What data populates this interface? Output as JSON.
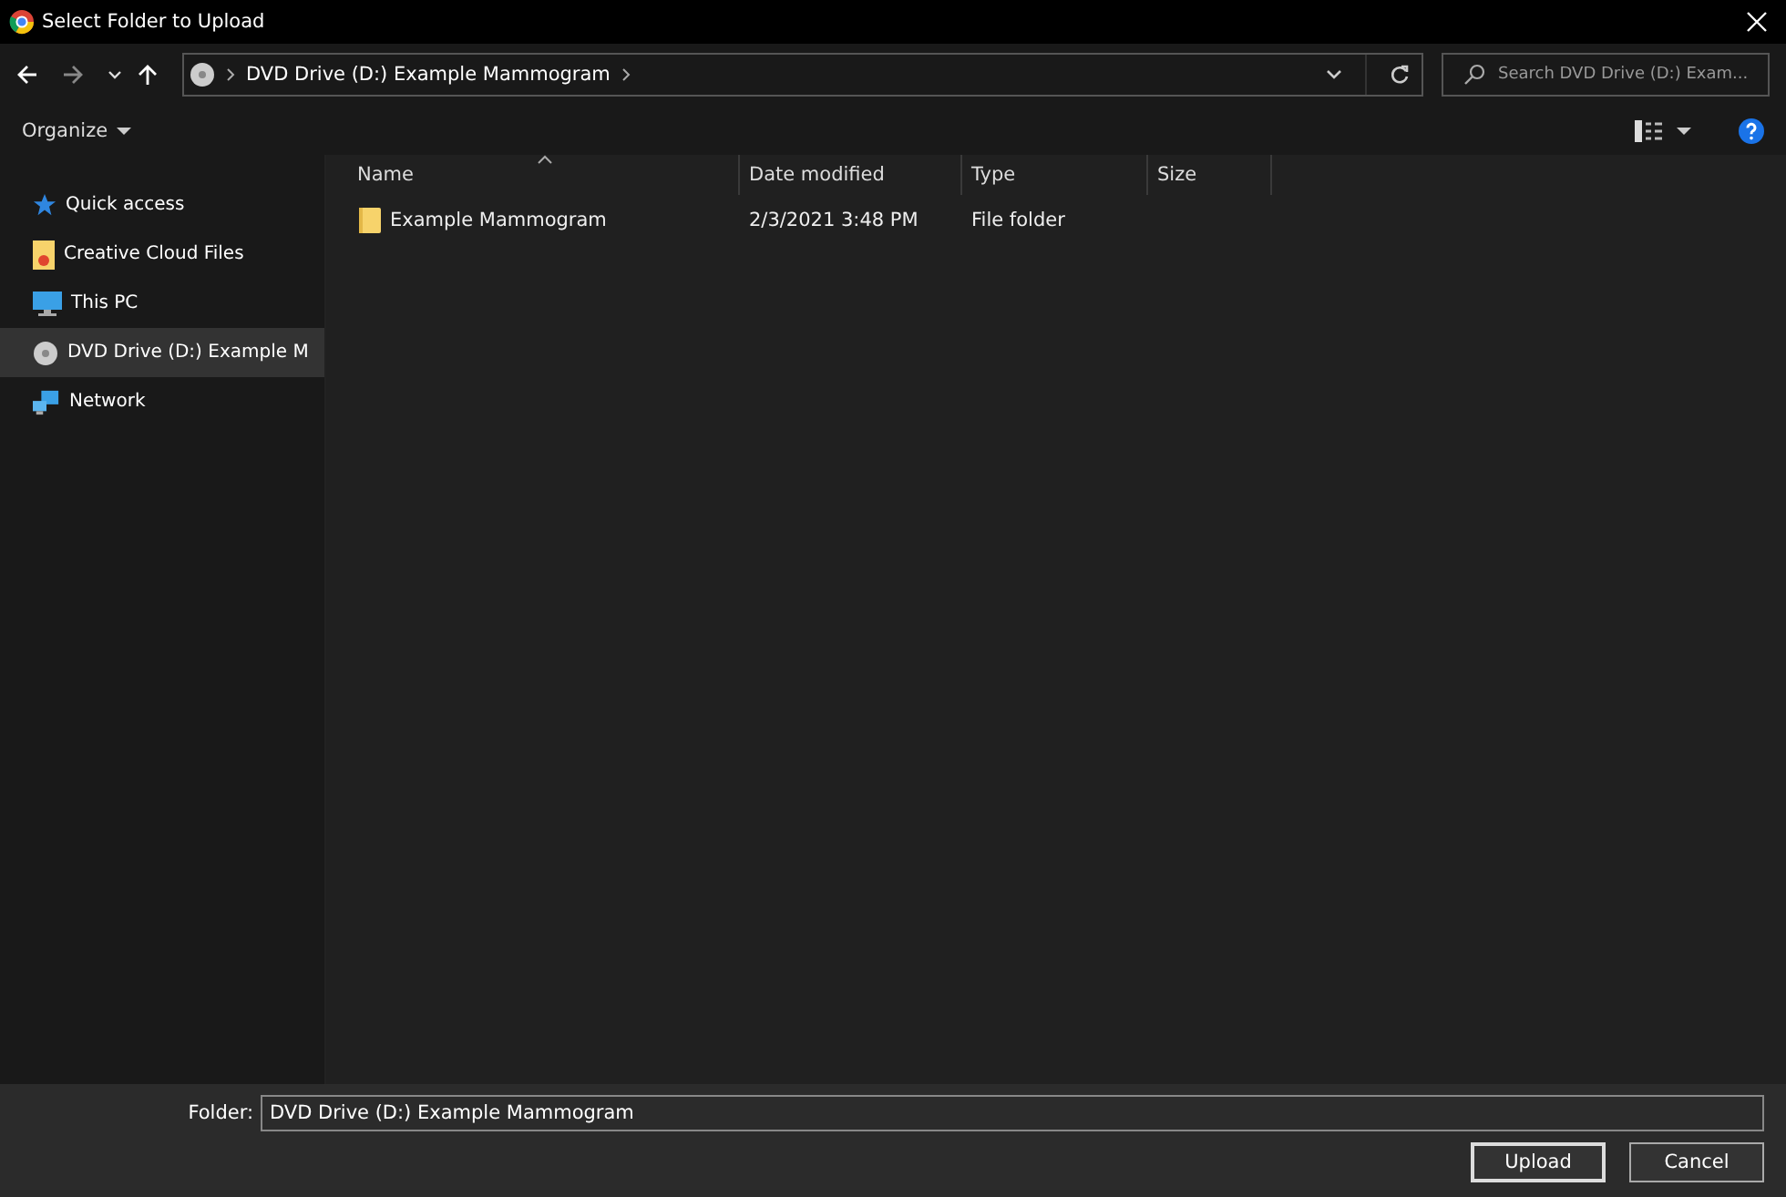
{
  "window": {
    "title": "Select Folder to Upload"
  },
  "address": {
    "path": "DVD Drive (D:) Example Mammogram",
    "search_placeholder": "Search DVD Drive (D:) Exam..."
  },
  "toolbar": {
    "organize": "Organize"
  },
  "sidebar": {
    "items": [
      {
        "kind": "star",
        "label": "Quick access",
        "selected": false
      },
      {
        "kind": "cloud",
        "label": "Creative Cloud Files",
        "selected": false
      },
      {
        "kind": "pc",
        "label": "This PC",
        "selected": false
      },
      {
        "kind": "disc",
        "label": "DVD Drive (D:) Example M",
        "selected": true
      },
      {
        "kind": "network",
        "label": "Network",
        "selected": false
      }
    ]
  },
  "table": {
    "columns": [
      "Name",
      "Date modified",
      "Type",
      "Size"
    ],
    "rows": [
      {
        "name": "Example Mammogram",
        "date": "2/3/2021 3:48 PM",
        "type": "File folder",
        "size": ""
      }
    ]
  },
  "footer": {
    "folder_label": "Folder:",
    "folder_value": "DVD Drive (D:) Example Mammogram",
    "buttons": [
      "Upload",
      "Cancel"
    ]
  }
}
